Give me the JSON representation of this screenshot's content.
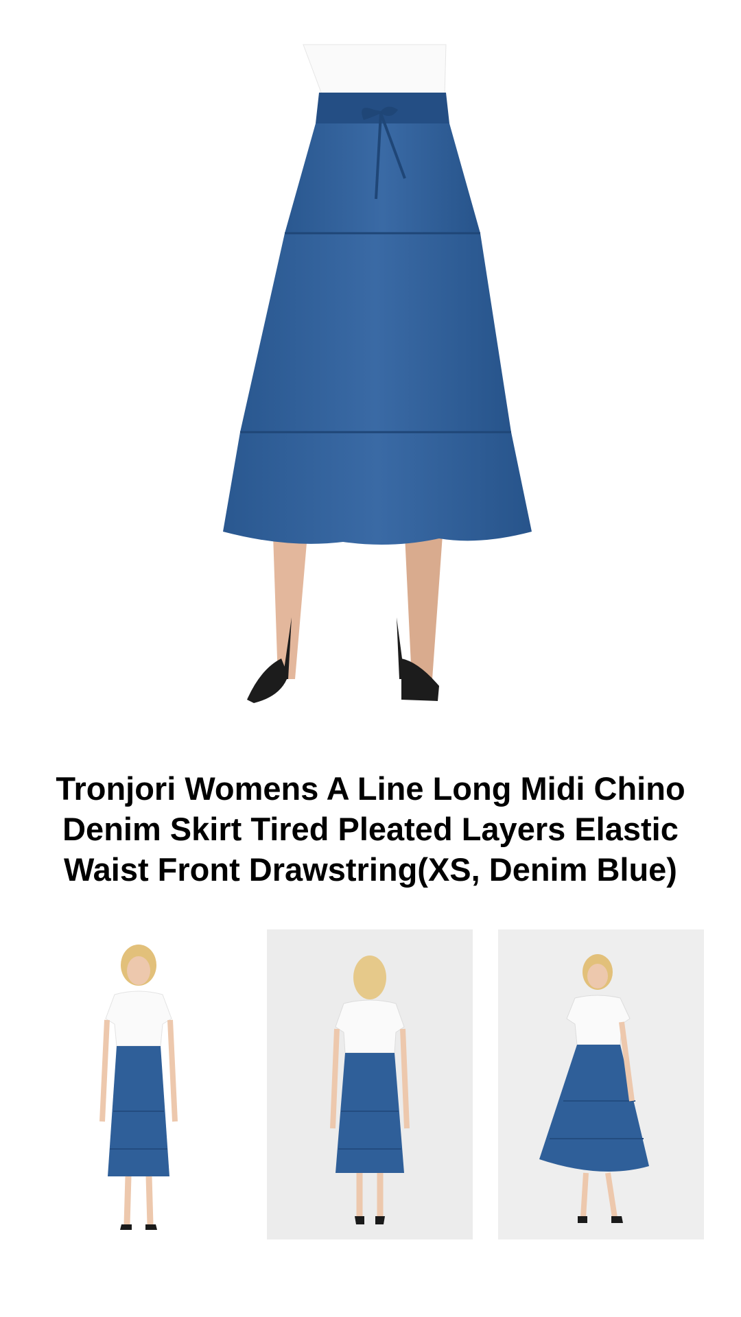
{
  "product": {
    "title": "Tronjori Womens A Line Long Midi Chino Denim Skirt Tired Pleated Layers Elastic Waist Front Drawstring(XS, Denim Blue)"
  },
  "colors": {
    "denim": "#2f5f99",
    "denim_dark": "#234c80",
    "background": "#ffffff",
    "thumb_bg": "#ececec"
  },
  "images": {
    "main": "denim-skirt-front-closeup",
    "thumbnails": [
      "model-front-view",
      "model-back-view",
      "model-twirl-view"
    ]
  }
}
